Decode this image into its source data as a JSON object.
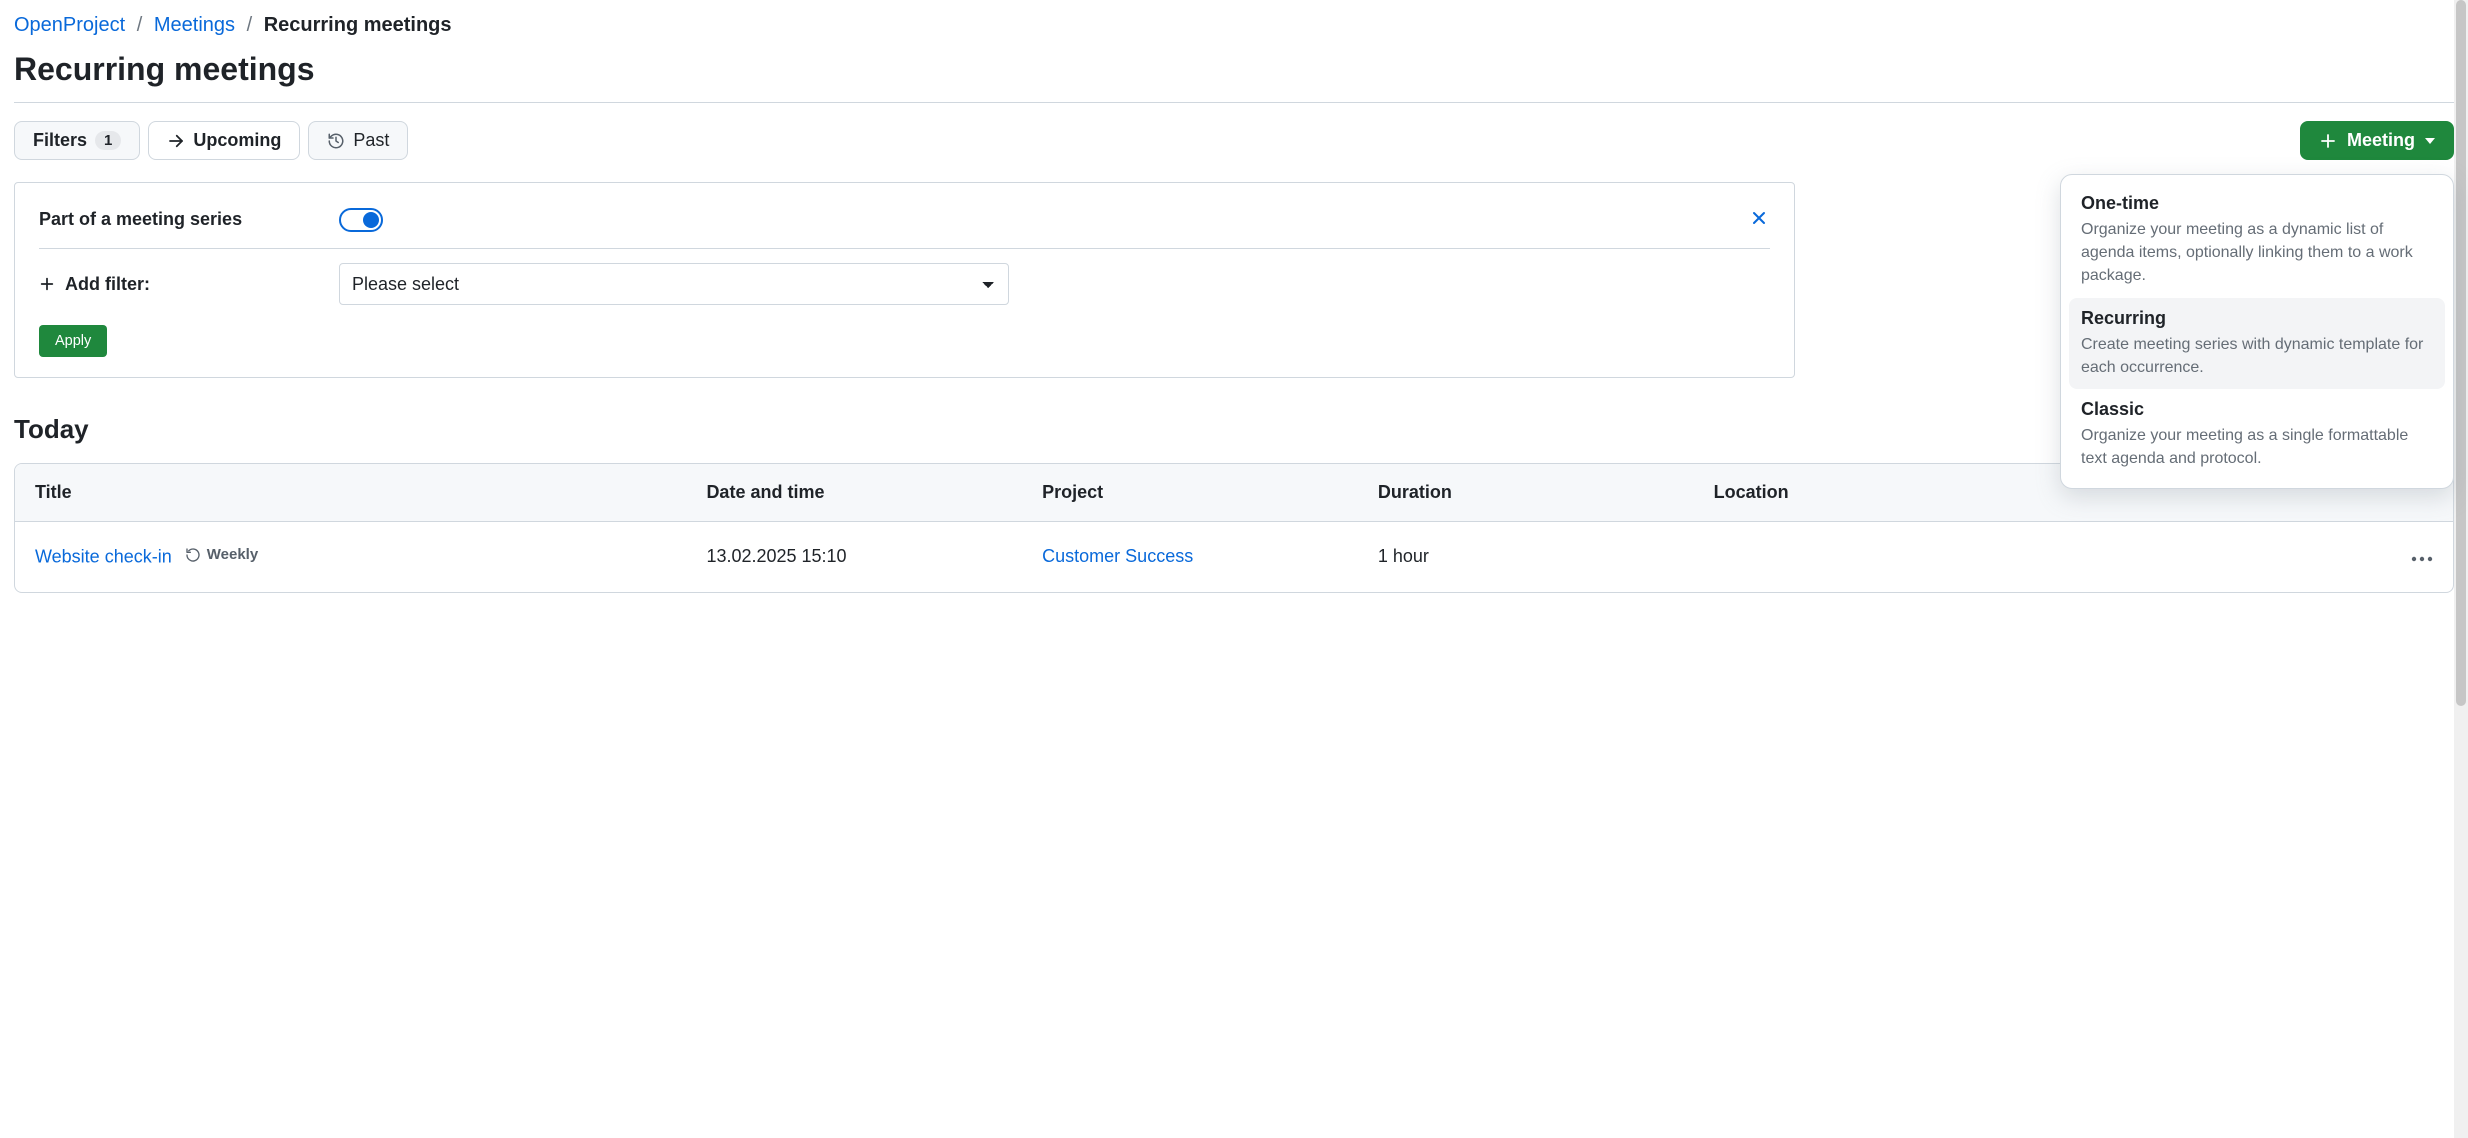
{
  "breadcrumb": {
    "root": "OpenProject",
    "module": "Meetings",
    "current": "Recurring meetings"
  },
  "page_title": "Recurring meetings",
  "toolbar": {
    "filters_label": "Filters",
    "filters_count": "1",
    "upcoming_label": "Upcoming",
    "past_label": "Past",
    "meeting_button": "Meeting"
  },
  "filters_panel": {
    "series_label": "Part of a meeting series",
    "series_on": true,
    "add_filter_label": "Add filter:",
    "select_placeholder": "Please select",
    "apply_label": "Apply"
  },
  "dropdown": {
    "items": [
      {
        "title": "One-time",
        "desc": "Organize your meeting as a dynamic list of agenda items, optionally linking them to a work package.",
        "highlight": false
      },
      {
        "title": "Recurring",
        "desc": "Create meeting series with dynamic template for each occurrence.",
        "highlight": true
      },
      {
        "title": "Classic",
        "desc": "Organize your meeting as a single formattable text agenda and protocol.",
        "highlight": false
      }
    ]
  },
  "section_heading": "Today",
  "table": {
    "headers": {
      "title": "Title",
      "date": "Date and time",
      "project": "Project",
      "duration": "Duration",
      "location": "Location"
    },
    "rows": [
      {
        "title": "Website check-in",
        "frequency": "Weekly",
        "date": "13.02.2025 15:10",
        "project": "Customer Success",
        "duration": "1 hour",
        "location": ""
      }
    ]
  }
}
